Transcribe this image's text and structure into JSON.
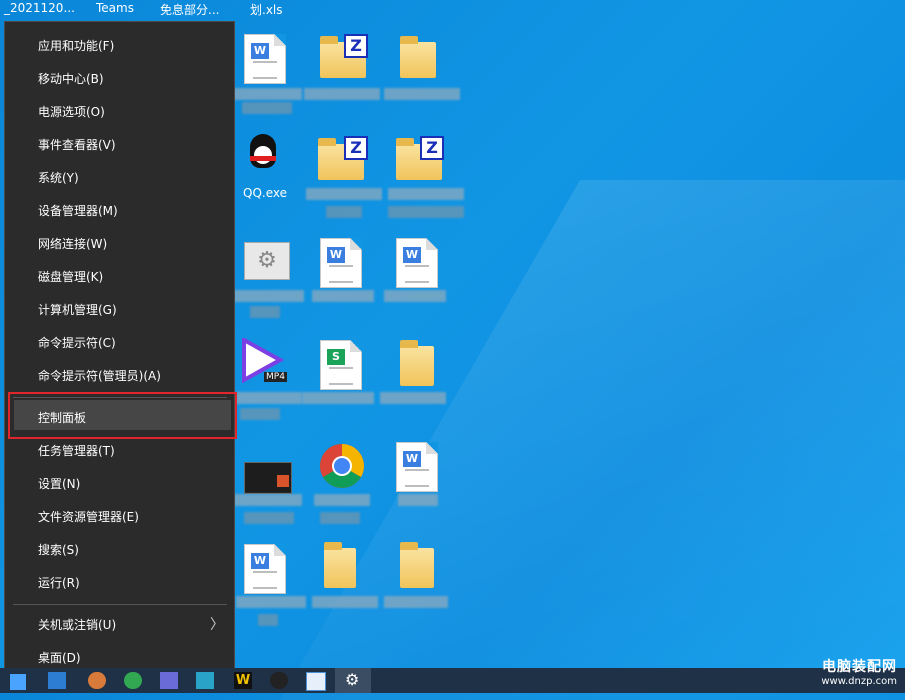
{
  "top_labels": [
    "_2021120...",
    "Teams",
    "免息部分...",
    "划.xls"
  ],
  "desktop": {
    "qq_label": "QQ.exe",
    "mp4_badge": "MP4"
  },
  "menu": {
    "items": [
      {
        "label": "应用和功能(F)"
      },
      {
        "label": "移动中心(B)"
      },
      {
        "label": "电源选项(O)"
      },
      {
        "label": "事件查看器(V)"
      },
      {
        "label": "系统(Y)"
      },
      {
        "label": "设备管理器(M)"
      },
      {
        "label": "网络连接(W)"
      },
      {
        "label": "磁盘管理(K)"
      },
      {
        "label": "计算机管理(G)"
      },
      {
        "label": "命令提示符(C)"
      },
      {
        "label": "命令提示符(管理员)(A)"
      },
      {
        "label": "控制面板"
      },
      {
        "label": "任务管理器(T)"
      },
      {
        "label": "设置(N)"
      },
      {
        "label": "文件资源管理器(E)"
      },
      {
        "label": "搜索(S)"
      },
      {
        "label": "运行(R)"
      },
      {
        "label": "关机或注销(U)"
      },
      {
        "label": "桌面(D)"
      }
    ],
    "highlighted": "控制面板",
    "highlight_color": "#e0262a"
  },
  "watermark": {
    "title": "电脑装配网",
    "url": "www.dnzp.com"
  }
}
